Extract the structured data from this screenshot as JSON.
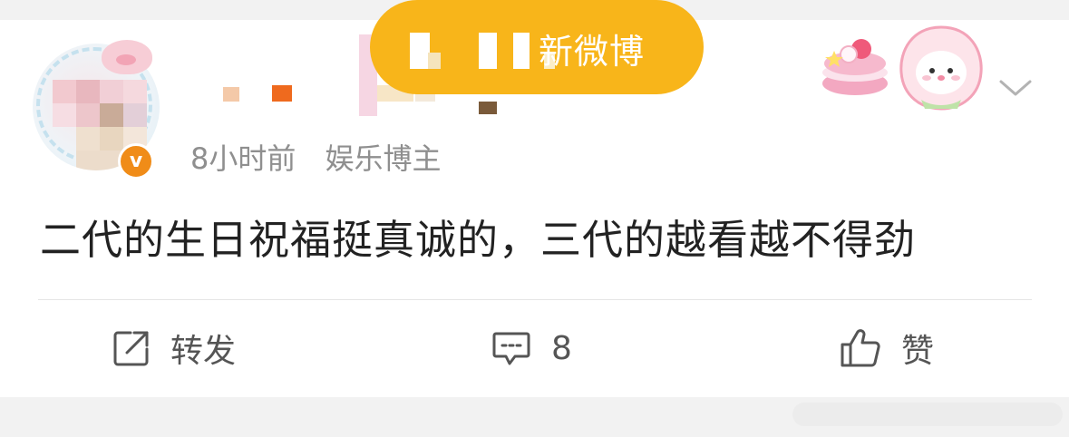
{
  "watermark": {
    "text": "新微博"
  },
  "post": {
    "time": "8小时前",
    "author_type": "娱乐博主",
    "text": "二代的生日祝福挺真诚的，三代的越看越不得劲",
    "verified_badge": "v"
  },
  "actions": {
    "repost_label": "转发",
    "comment_count": "8",
    "like_label": "赞"
  },
  "icons": [
    "share-icon",
    "comment-icon",
    "thumbs-up-icon",
    "chevron-down-icon"
  ],
  "colors": {
    "accent_orange": "#f08c18",
    "pill_yellow": "#f8b51a",
    "text_primary": "#222222",
    "text_muted": "#8f8f8f"
  }
}
